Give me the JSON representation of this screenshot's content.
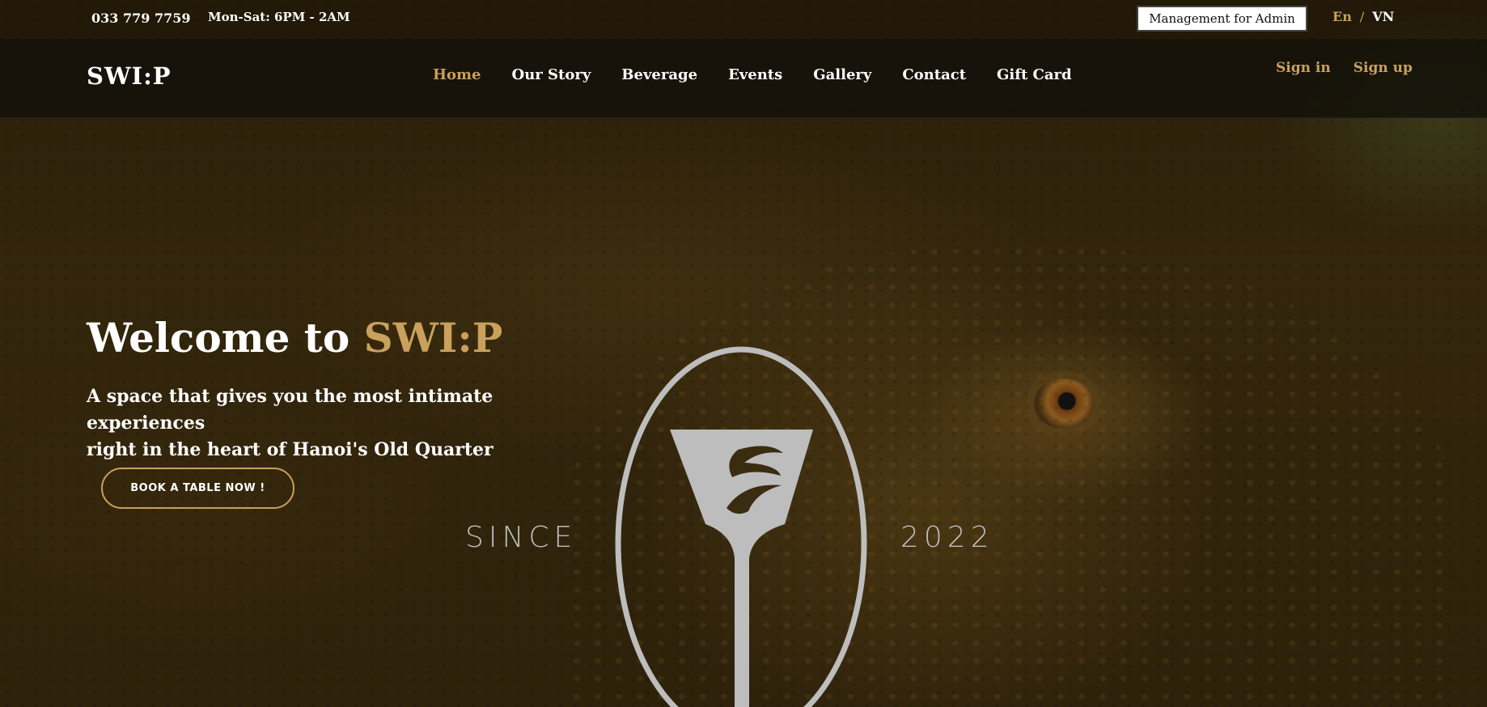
{
  "topbar": {
    "phone": "033 779 7759",
    "hours": "Mon-Sat: 6PM - 2AM",
    "admin_label": "Management for Admin",
    "lang_en": "En",
    "lang_sep": "/",
    "lang_vn": "VN"
  },
  "nav": {
    "logo": "SWI:P",
    "links": [
      "Home",
      "Our Story",
      "Beverage",
      "Events",
      "Gallery",
      "Contact",
      "Gift Card"
    ],
    "active": "Home",
    "sign_in": "Sign in",
    "sign_up": "Sign up"
  },
  "hero": {
    "welcome_prefix": "Welcome to",
    "welcome_brand": "SWI:P",
    "tagline_line1": "A space that gives you the most intimate experiences",
    "tagline_line2": "right in the heart of Hanoi's Old Quarter",
    "book_label": "BOOK A TABLE NOW !",
    "since_label": "SINCE",
    "year_label": "2022"
  },
  "colors": {
    "accent": "#c9a05c",
    "emblem": "#bdbdbd",
    "navbar_bg": "#121008"
  }
}
